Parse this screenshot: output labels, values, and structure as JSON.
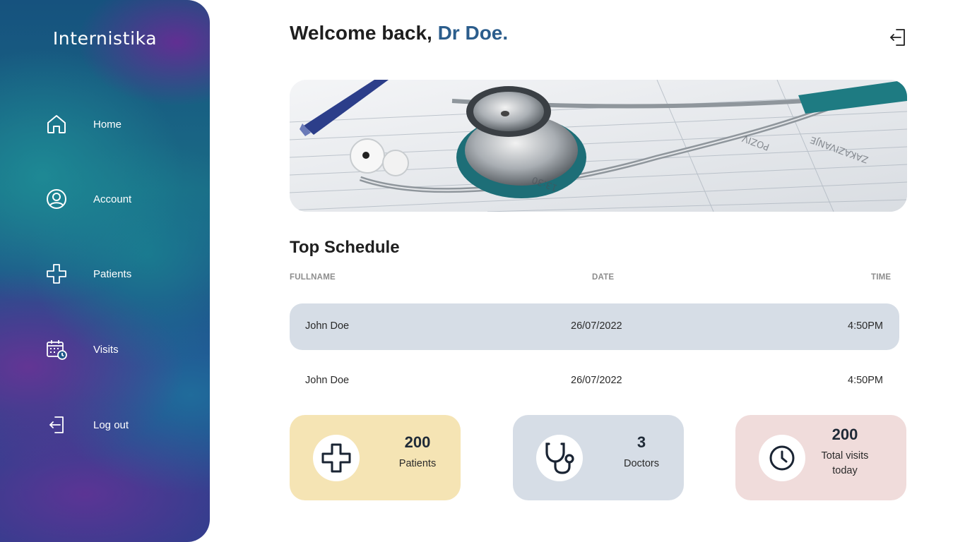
{
  "sidebar": {
    "brand": "Internistika",
    "items": [
      {
        "label": "Home",
        "icon": "home-icon"
      },
      {
        "label": "Account",
        "icon": "user-circle-icon"
      },
      {
        "label": "Patients",
        "icon": "plus-cross-icon"
      },
      {
        "label": "Visits",
        "icon": "calendar-clock-icon"
      },
      {
        "label": "Log out",
        "icon": "logout-icon"
      }
    ]
  },
  "header": {
    "greeting": "Welcome back, ",
    "name": "Dr Doe.",
    "logout_icon": "logout-icon"
  },
  "banner": {
    "image": "stethoscope-on-schedule-papers"
  },
  "schedule": {
    "title": "Top Schedule",
    "columns": [
      "FULLNAME",
      "DATE",
      "TIME"
    ],
    "rows": [
      {
        "fullname": "John Doe",
        "date": "26/07/2022",
        "time": "4:50PM"
      },
      {
        "fullname": "John Doe",
        "date": "26/07/2022",
        "time": "4:50PM"
      }
    ]
  },
  "stats": [
    {
      "value": "200",
      "label": "Patients",
      "icon": "plus-cross-icon",
      "color": "#f5e4b4"
    },
    {
      "value": "3",
      "label": "Doctors",
      "icon": "stethoscope-icon",
      "color": "#d6dde6"
    },
    {
      "value": "200",
      "label_line1": "Total visits",
      "label_line2": "today",
      "icon": "clock-icon",
      "color": "#f0dcdb"
    }
  ],
  "colors": {
    "accent_name": "#2b5d8c",
    "active_row": "#d6dde6",
    "text_dark": "#1f1f1f"
  }
}
